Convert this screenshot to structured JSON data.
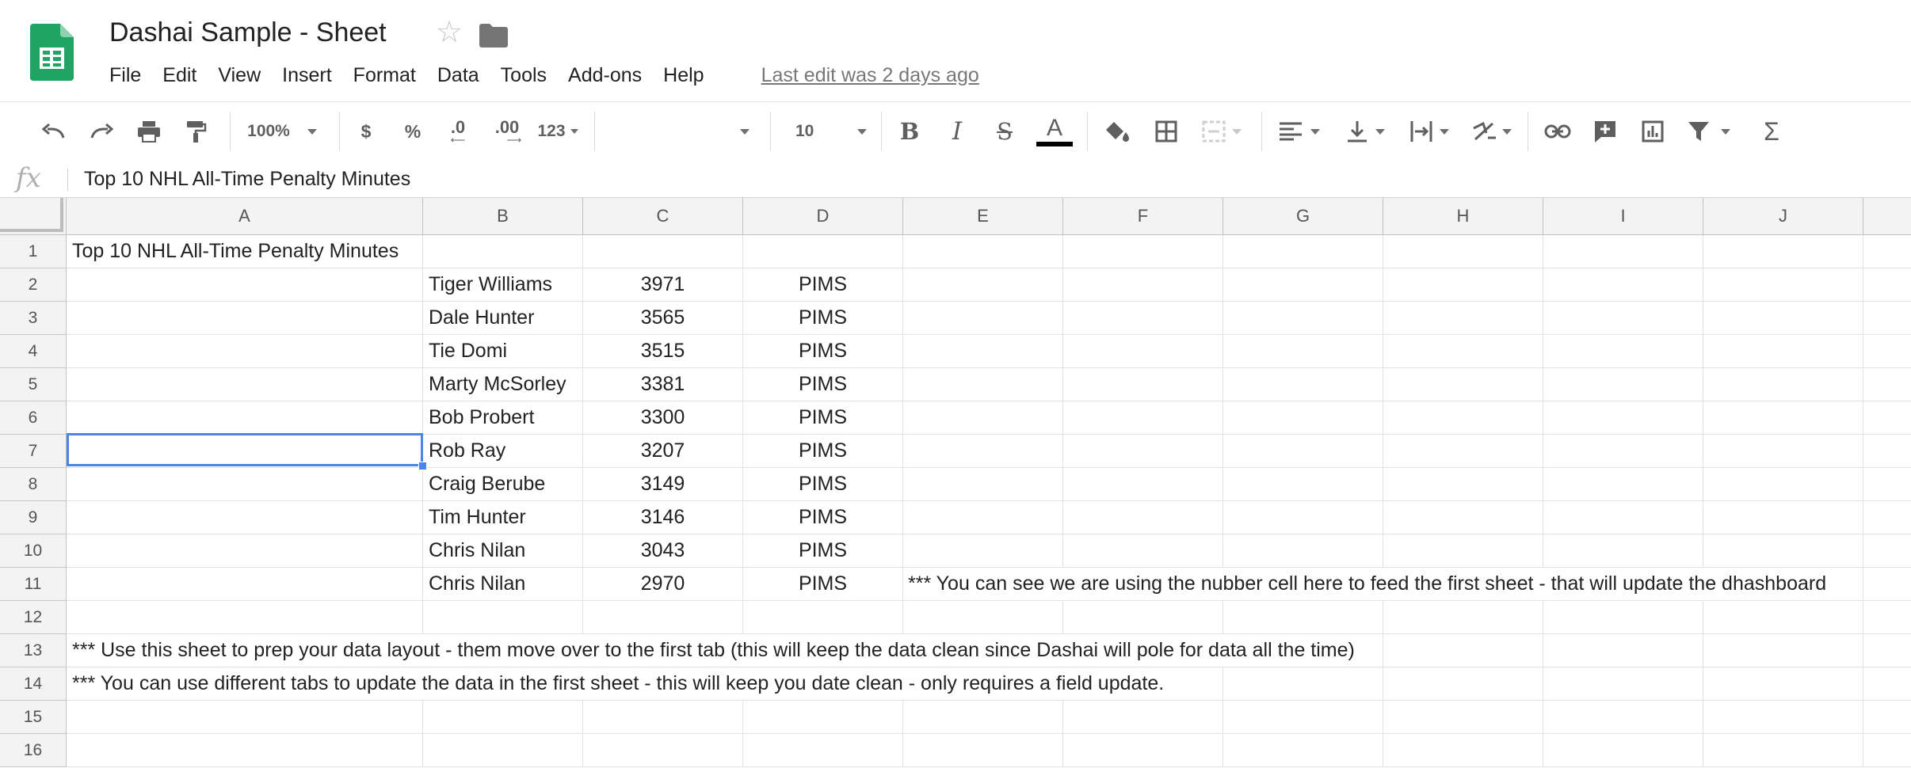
{
  "header": {
    "title": "Dashai Sample - Sheet",
    "menu": [
      "File",
      "Edit",
      "View",
      "Insert",
      "Format",
      "Data",
      "Tools",
      "Add-ons",
      "Help"
    ],
    "last_edit": "Last edit was 2 days ago",
    "brand_color": "#1fa463"
  },
  "toolbar": {
    "zoom": "100%",
    "currency": "$",
    "percent": "%",
    "decrease_decimals": ".0",
    "increase_decimals": ".00",
    "more_formats": "123",
    "font_family": "",
    "font_size": "10",
    "text_color_letter": "A"
  },
  "formula_bar": {
    "fx": "fx",
    "content": "Top 10 NHL All-Time Penalty Minutes"
  },
  "grid": {
    "columns": [
      "A",
      "B",
      "C",
      "D",
      "E",
      "F",
      "G",
      "H",
      "I",
      "J"
    ],
    "rows": [
      "1",
      "2",
      "3",
      "4",
      "5",
      "6",
      "7",
      "8",
      "9",
      "10",
      "11",
      "12",
      "13",
      "14",
      "15",
      "16"
    ],
    "selected_cell": "A1",
    "a1": "Top 10 NHL All-Time Penalty Minutes",
    "players": [
      {
        "name": "Tiger Williams",
        "pim": "3971",
        "unit": "PIMS"
      },
      {
        "name": "Dale Hunter",
        "pim": "3565",
        "unit": "PIMS"
      },
      {
        "name": "Tie Domi",
        "pim": "3515",
        "unit": "PIMS"
      },
      {
        "name": "Marty McSorley",
        "pim": "3381",
        "unit": "PIMS"
      },
      {
        "name": "Bob Probert",
        "pim": "3300",
        "unit": "PIMS"
      },
      {
        "name": "Rob Ray",
        "pim": "3207",
        "unit": "PIMS"
      },
      {
        "name": "Craig Berube",
        "pim": "3149",
        "unit": "PIMS"
      },
      {
        "name": "Tim Hunter",
        "pim": "3146",
        "unit": "PIMS"
      },
      {
        "name": "Chris Nilan",
        "pim": "3043",
        "unit": "PIMS"
      },
      {
        "name": "Chris Nilan",
        "pim": "2970",
        "unit": "PIMS"
      }
    ],
    "note_e11": "*** You can see we are using the nubber cell here to feed the first sheet - that will update the dhashboard",
    "note_a13": "*** Use this sheet to prep your data layout - them move over to the first tab (this will keep the data clean since Dashai will pole for data all the time)",
    "note_a14": "*** You can use different tabs to update the data in the first sheet - this will keep you date clean - only requires a field update."
  }
}
